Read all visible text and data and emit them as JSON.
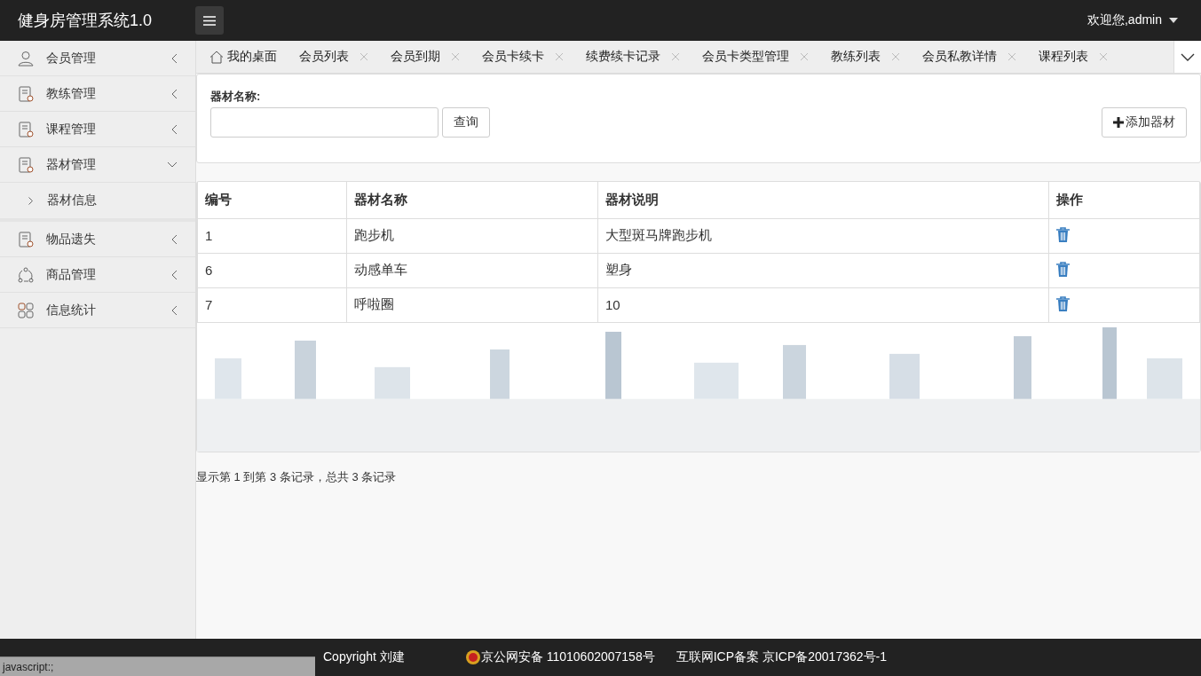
{
  "header": {
    "title": "健身房管理系统1.0",
    "user": "欢迎您,admin"
  },
  "sidebar": {
    "items": [
      {
        "label": "会员管理",
        "expanded": false
      },
      {
        "label": "教练管理",
        "expanded": false
      },
      {
        "label": "课程管理",
        "expanded": false
      },
      {
        "label": "器材管理",
        "expanded": true,
        "children": [
          {
            "label": "器材信息"
          }
        ]
      },
      {
        "label": "物品遗失",
        "expanded": false
      },
      {
        "label": "商品管理",
        "expanded": false
      },
      {
        "label": "信息统计",
        "expanded": false
      }
    ]
  },
  "tabs": [
    {
      "label": "我的桌面",
      "kind": "home",
      "selected": false
    },
    {
      "label": "会员列表",
      "kind": "page",
      "selected": false
    },
    {
      "label": "会员到期",
      "kind": "page",
      "selected": false
    },
    {
      "label": "会员卡续卡",
      "kind": "page",
      "selected": false
    },
    {
      "label": "续费续卡记录",
      "kind": "page",
      "selected": false
    },
    {
      "label": "会员卡类型管理",
      "kind": "page",
      "selected": false
    },
    {
      "label": "教练列表",
      "kind": "page",
      "selected": false
    },
    {
      "label": "会员私教详情",
      "kind": "page",
      "selected": false
    },
    {
      "label": "课程列表",
      "kind": "page",
      "selected": false
    }
  ],
  "search": {
    "label": "器材名称:",
    "query_button": "查询",
    "add_button": "添加器材"
  },
  "table": {
    "columns": [
      "编号",
      "器材名称",
      "器材说明",
      "操作"
    ],
    "rows": [
      [
        "1",
        "跑步机",
        "大型斑马牌跑步机"
      ],
      [
        "6",
        "动感单车",
        "塑身"
      ],
      [
        "7",
        "呼啦圈",
        "10"
      ]
    ]
  },
  "pagination": "显示第 1 到第 3 条记录，总共 3 条记录",
  "footer": {
    "copyright": "Copyright 刘建",
    "police": "京公网安备 11010602007158号",
    "icp": "互联网ICP备案 京ICP备20017362号-1"
  },
  "status_bar": "javascript:;"
}
